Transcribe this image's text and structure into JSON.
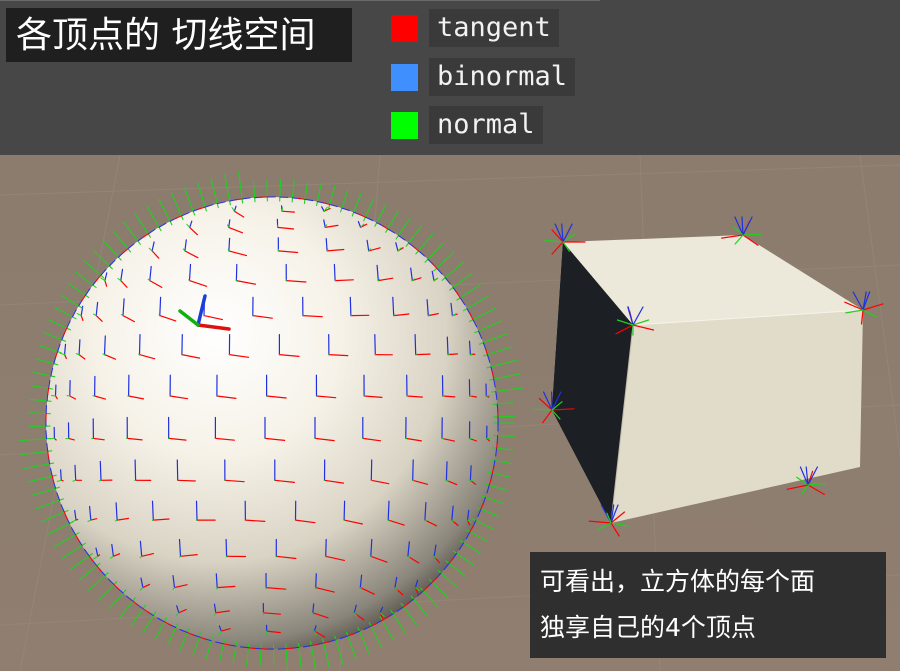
{
  "header": {
    "title": "各顶点的 切线空间"
  },
  "legend": [
    {
      "label": "tangent",
      "color": "#ff0000"
    },
    {
      "label": "binormal",
      "color": "#3f8fff"
    },
    {
      "label": "normal",
      "color": "#00ff00"
    }
  ],
  "scene": {
    "background": "#8d7d6f",
    "objects": [
      "sphere",
      "cube"
    ]
  },
  "caption": {
    "line1": "可看出，立方体的每个面",
    "line2": "独享自己的4个顶点"
  }
}
